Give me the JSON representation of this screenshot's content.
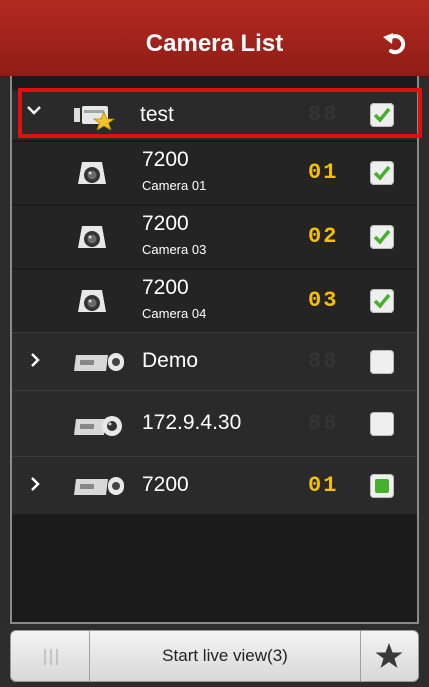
{
  "header": {
    "title": "Camera List",
    "back_icon": "undo-icon"
  },
  "tree": {
    "group": {
      "label": "test",
      "channel": "88",
      "checked": true,
      "selected": true,
      "expanded": true
    },
    "cameras": [
      {
        "title": "7200",
        "subtitle": "Camera 01",
        "channel": "01",
        "checked": true
      },
      {
        "title": "7200",
        "subtitle": "Camera 03",
        "channel": "02",
        "checked": true
      },
      {
        "title": "7200",
        "subtitle": "Camera 04",
        "channel": "03",
        "checked": true
      }
    ],
    "devices": [
      {
        "label": "Demo",
        "channel": "88",
        "checked": false,
        "expandable": true
      },
      {
        "label": "172.9.4.30",
        "channel": "88",
        "checked": false,
        "expandable": false
      },
      {
        "label": "7200",
        "channel": "01",
        "checked": "partial",
        "expandable": true
      }
    ]
  },
  "bottom": {
    "start_label": "Start live view(3)",
    "grip_icon": "grip-icon",
    "favorite_icon": "star-icon"
  },
  "colors": {
    "header": "#a3241b",
    "selection": "#e01010",
    "channel_active": "#f5c000",
    "check": "#46b02c"
  }
}
